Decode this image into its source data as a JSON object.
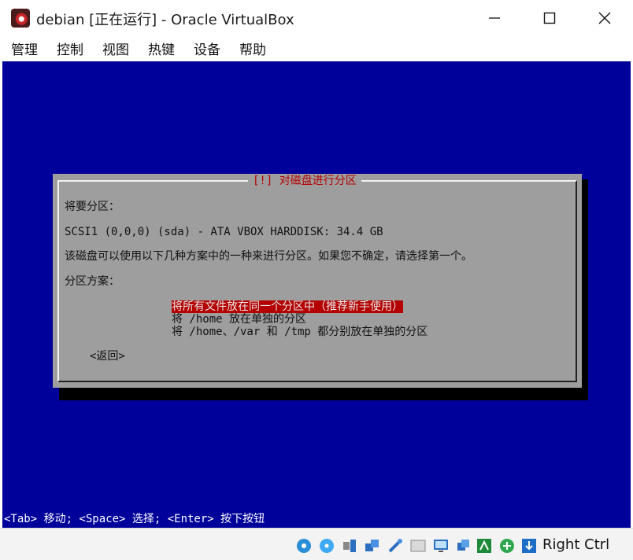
{
  "window": {
    "title": "debian [正在运行] - Oracle VirtualBox"
  },
  "menu": [
    "管理",
    "控制",
    "视图",
    "热键",
    "设备",
    "帮助"
  ],
  "installer": {
    "dialog_title": "[!] 对磁盘进行分区",
    "label_partition": "将要分区：",
    "disk": "SCSI1 (0,0,0) (sda) - ATA VBOX HARDDISK: 34.4 GB",
    "description": "该磁盘可以使用以下几种方案中的一种来进行分区。如果您不确定，请选择第一个。",
    "scheme_label": "分区方案：",
    "options": [
      "将所有文件放在同一个分区中（推荐新手使用）",
      "将 /home 放在单独的分区",
      "将 /home、/var 和 /tmp 都分别放在单独的分区"
    ],
    "selected_index": 0,
    "back_button": "<返回>",
    "help_line": "<Tab> 移动; <Space> 选择; <Enter> 按下按钮"
  },
  "statusbar": {
    "icons": [
      "hard-disk-icon",
      "optical-drive-icon",
      "audio-icon",
      "network-icon",
      "usb-icon",
      "shared-folders-icon",
      "display-icon",
      "recording-icon",
      "cpu-icon",
      "mouse-integration-icon",
      "keyboard-icon"
    ],
    "host_key": "Right Ctrl"
  },
  "colors": {
    "vm_background": "#00009a",
    "dialog_gray": "#9e9e9e",
    "accent_red": "#b40000"
  }
}
